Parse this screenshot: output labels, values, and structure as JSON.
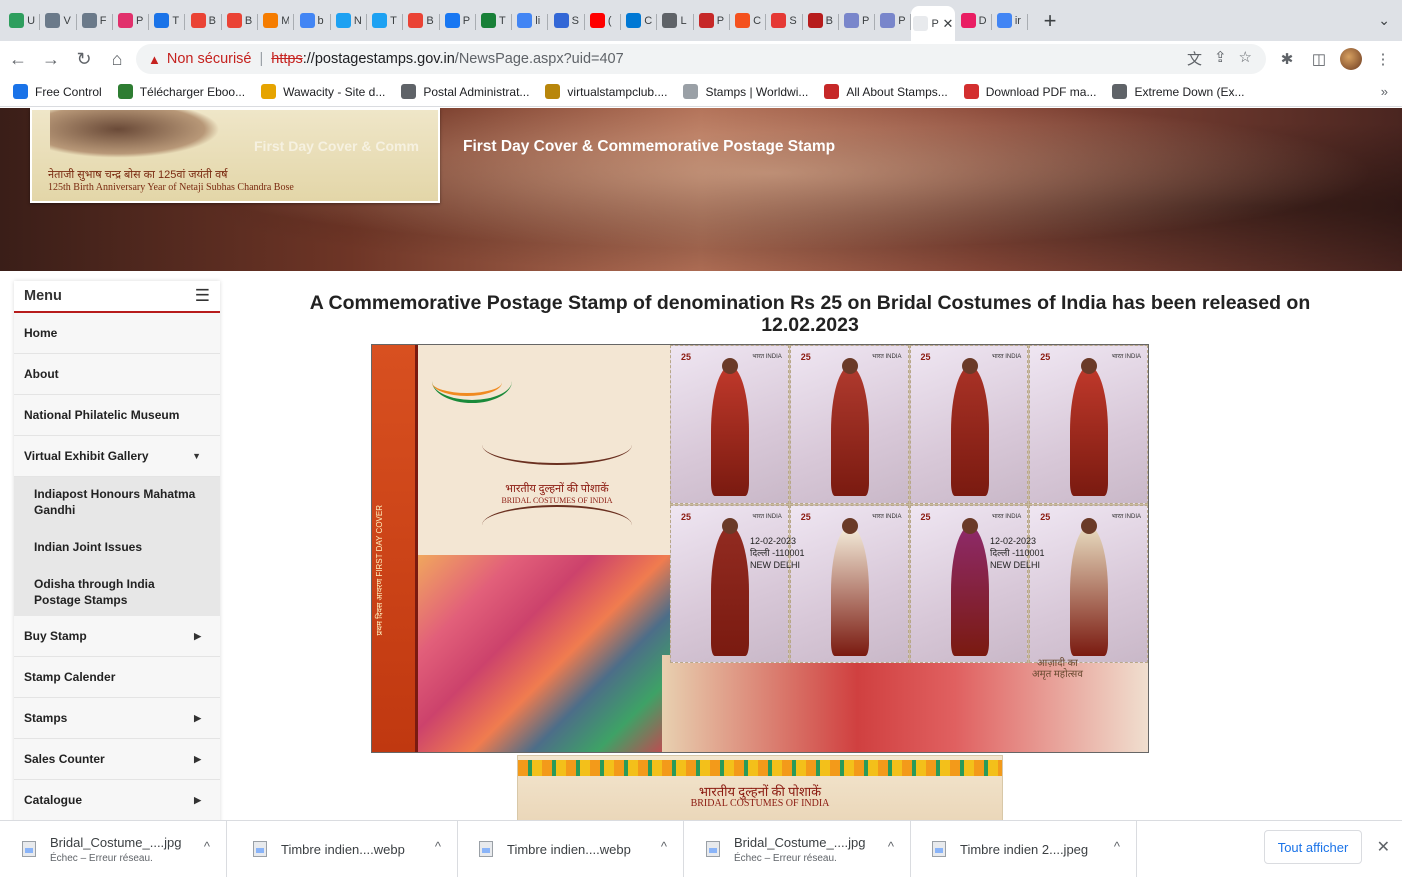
{
  "browser": {
    "tabs": [
      {
        "letter": "U",
        "color": "#2e9e5e"
      },
      {
        "letter": "V",
        "color": "#6b7a8a"
      },
      {
        "letter": "F",
        "color": "#6b7a8a"
      },
      {
        "letter": "P",
        "color": "#e1306c"
      },
      {
        "letter": "T",
        "color": "#1a73e8"
      },
      {
        "letter": "B",
        "color": "#ea4335"
      },
      {
        "letter": "B",
        "color": "#ea4335"
      },
      {
        "letter": "M",
        "color": "#f57c00"
      },
      {
        "letter": "b",
        "color": "#4285f4"
      },
      {
        "letter": "N",
        "color": "#1da1f2"
      },
      {
        "letter": "T",
        "color": "#1da1f2"
      },
      {
        "letter": "B",
        "color": "#ea4335"
      },
      {
        "letter": "P",
        "color": "#1877f2"
      },
      {
        "letter": "T",
        "color": "#188038"
      },
      {
        "letter": "li",
        "color": "#4285f4"
      },
      {
        "letter": "S",
        "color": "#3367d6"
      },
      {
        "letter": "(",
        "color": "#ff0000"
      },
      {
        "letter": "C",
        "color": "#0078d4"
      },
      {
        "letter": "L",
        "color": "#5f6368"
      },
      {
        "letter": "P",
        "color": "#c62828"
      },
      {
        "letter": "C",
        "color": "#f4511e"
      },
      {
        "letter": "S",
        "color": "#e53935"
      },
      {
        "letter": "B",
        "color": "#b71c1c"
      },
      {
        "letter": "P",
        "color": "#7986cb"
      },
      {
        "letter": "P",
        "color": "#7986cb"
      }
    ],
    "active_tab": {
      "label": "Pc",
      "close": "✕"
    },
    "tabs_after": [
      {
        "letter": "D",
        "color": "#e91e63"
      },
      {
        "letter": "ir",
        "color": "#4285f4"
      }
    ],
    "new_tab": "+",
    "tab_search": "⌄",
    "nav": {
      "back": "←",
      "forward": "→",
      "reload": "↻",
      "home": "⌂"
    },
    "address": {
      "warning_icon": "▲",
      "security_label": "Non sécurisé",
      "separator": "|",
      "scheme": "https",
      "host_sep": "://",
      "host": "postagestamps.gov.in",
      "path": "/NewsPage.aspx?uid=407"
    },
    "omni_icons": {
      "translate": "文",
      "share": "⇪",
      "star": "☆"
    },
    "toolbar_icons": {
      "extensions": "✱",
      "sidepanel": "◫",
      "menu": "⋮"
    },
    "bookmarks": [
      {
        "label": "Free Control",
        "color": "#1a73e8"
      },
      {
        "label": "Télécharger Eboo...",
        "color": "#2e7d32"
      },
      {
        "label": "Wawacity - Site d...",
        "color": "#e6a400"
      },
      {
        "label": "Postal Administrat...",
        "color": "#5f6368"
      },
      {
        "label": "virtualstampclub....",
        "color": "#b8860b"
      },
      {
        "label": "Stamps | Worldwi...",
        "color": "#9aa0a6"
      },
      {
        "label": "All About Stamps...",
        "color": "#c62828"
      },
      {
        "label": "Download PDF ma...",
        "color": "#d32f2f"
      },
      {
        "label": "Extreme Down (Ex...",
        "color": "#5f6368"
      }
    ],
    "bookmarks_more": "»"
  },
  "hero": {
    "card_text_hi": "नेताजी सुभाष चन्द्र बोस का 125वां जयंती वर्ष",
    "card_text_en": "125th Birth Anniversary Year of Netaji Subhas Chandra Bose",
    "faded_title": "First Day Cover & Comm",
    "title": "First Day Cover & Commemorative Postage Stamp"
  },
  "sidebar": {
    "title": "Menu",
    "hamburger": "☰",
    "items": [
      {
        "label": "Home",
        "caret": ""
      },
      {
        "label": "About",
        "caret": ""
      },
      {
        "label": "National Philatelic Museum",
        "caret": ""
      },
      {
        "label": "Virtual Exhibit Gallery",
        "caret": "▼"
      }
    ],
    "subitems": [
      "Indiapost Honours Mahatma Gandhi",
      "Indian Joint Issues",
      "Odisha through India Postage Stamps"
    ],
    "items2": [
      {
        "label": "Buy Stamp",
        "caret": "▶"
      },
      {
        "label": "Stamp Calender",
        "caret": ""
      },
      {
        "label": "Stamps",
        "caret": "▶"
      },
      {
        "label": "Sales Counter",
        "caret": "▶"
      },
      {
        "label": "Catalogue",
        "caret": "▶"
      }
    ]
  },
  "main": {
    "headline": "A Commemorative Postage Stamp of denomination Rs 25 on Bridal Costumes of India has been released on 12.02.2023",
    "sheet": {
      "band_text": "प्रथम दिवस आवरण  FIRST DAY COVER",
      "title_hi": "भारतीय दुल्हनों की पोशाकें",
      "title_en": "BRIDAL COSTUMES OF INDIA",
      "stamps": [
        {
          "value": "25",
          "country": "भारत INDIA",
          "color": "#c0392b"
        },
        {
          "value": "25",
          "country": "भारत INDIA",
          "color": "#b03a2e"
        },
        {
          "value": "25",
          "country": "भारत INDIA",
          "color": "#a93226"
        },
        {
          "value": "25",
          "country": "भारत INDIA",
          "color": "#c0392b"
        },
        {
          "value": "25",
          "country": "भारत INDIA",
          "color": "#922b21"
        },
        {
          "value": "25",
          "country": "भारत INDIA",
          "color": "#f5eedc"
        },
        {
          "value": "25",
          "country": "भारत INDIA",
          "color": "#8e2a6a"
        },
        {
          "value": "25",
          "country": "भारत INDIA",
          "color": "#e8dcc0"
        }
      ],
      "postmark": {
        "date": "12-02-2023",
        "city_hi": "दिल्ली -110001",
        "city_en": "NEW DELHI"
      },
      "azadi_hi": "आज़ादी का",
      "azadi_hi2": "अमृत महोत्सव"
    },
    "banner": {
      "title_hi": "भारतीय दुल्हनों की पोशाकें",
      "title_en": "BRIDAL COSTUMES OF INDIA"
    }
  },
  "downloads": {
    "items": [
      {
        "name": "Bridal_Costume_....jpg",
        "status": "Échec – Erreur réseau."
      },
      {
        "name": "Timbre indien....webp",
        "status": ""
      },
      {
        "name": "Timbre indien....webp",
        "status": ""
      },
      {
        "name": "Bridal_Costume_....jpg",
        "status": "Échec – Erreur réseau."
      },
      {
        "name": "Timbre indien 2....jpeg",
        "status": ""
      }
    ],
    "chevron": "^",
    "show_all": "Tout afficher",
    "close": "✕"
  }
}
